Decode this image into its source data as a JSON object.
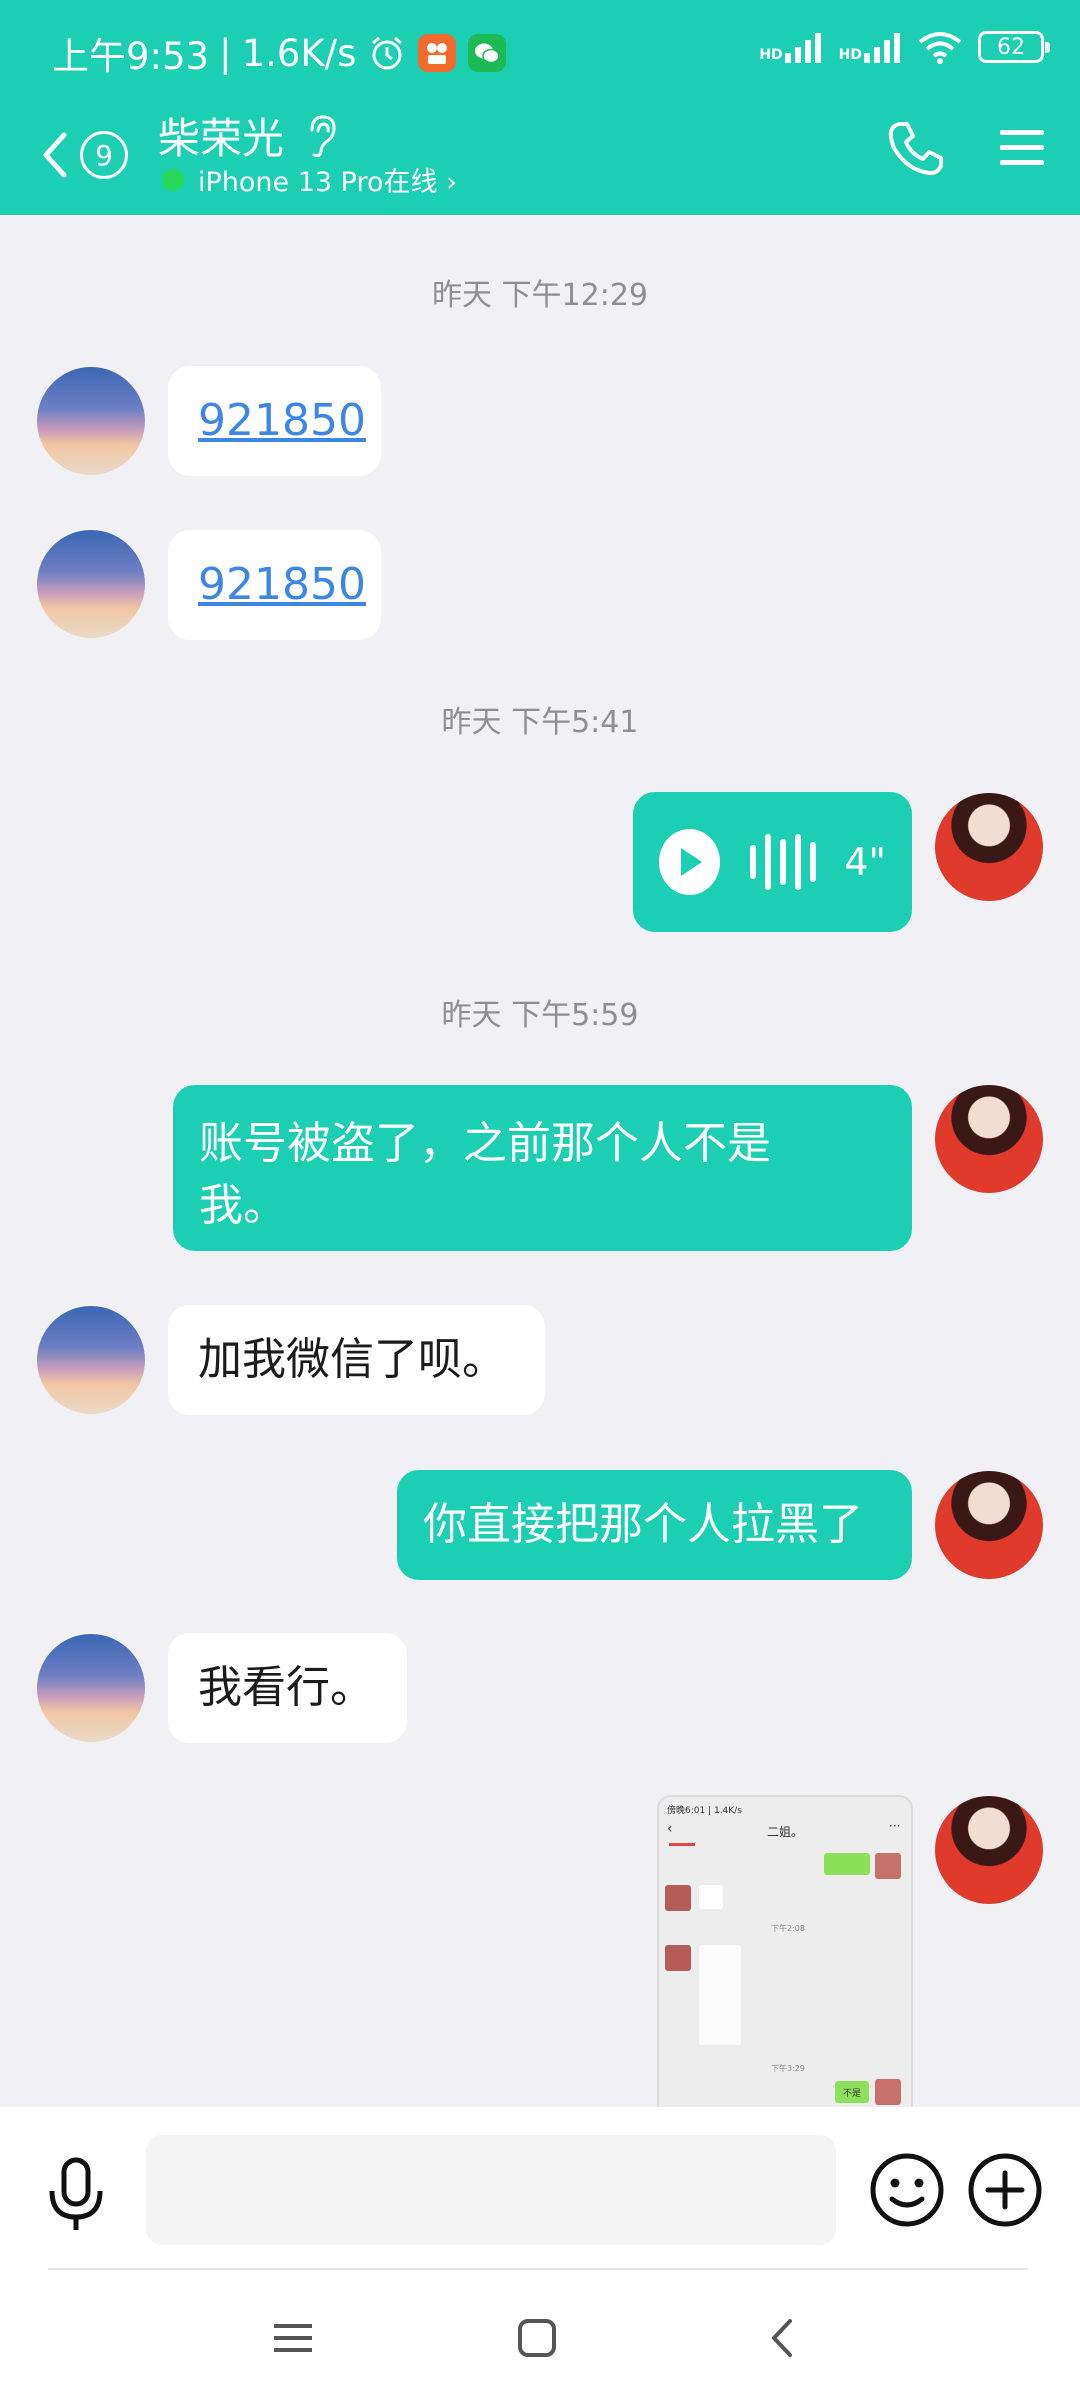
{
  "status_bar": {
    "time": "上午9:53",
    "speed": "1.6K/s",
    "battery": "62",
    "signal_label_1": "HD",
    "signal_label_2": "HD"
  },
  "header": {
    "unread_count": "9",
    "contact_name": "柴荣光",
    "online_status": "iPhone 13 Pro在线 ›",
    "accent_color": "#1ccfb2"
  },
  "messages": [
    {
      "type": "time",
      "text": "昨天 下午12:29"
    },
    {
      "type": "text",
      "from": "peer",
      "text": "921850",
      "is_link": true
    },
    {
      "type": "text",
      "from": "peer",
      "text": "921850",
      "is_link": true
    },
    {
      "type": "time",
      "text": "昨天 下午5:41"
    },
    {
      "type": "voice",
      "from": "self",
      "duration": "4\""
    },
    {
      "type": "time",
      "text": "昨天 下午5:59"
    },
    {
      "type": "text",
      "from": "self",
      "line1": "账号被盗了，之前那个人不是",
      "line2": "我。"
    },
    {
      "type": "text",
      "from": "peer",
      "text": "加我微信了呗。"
    },
    {
      "type": "text",
      "from": "self",
      "text": "你直接把那个人拉黑了"
    },
    {
      "type": "text",
      "from": "peer",
      "text": "我看行。"
    },
    {
      "type": "image",
      "from": "self"
    }
  ],
  "image_preview": {
    "status": "傍晚6:01 | 1.4K/s",
    "title": "二姐。",
    "time1": "下午2:08",
    "time2": "下午3:29",
    "bubble": "不是"
  },
  "input": {
    "placeholder": "",
    "value": ""
  },
  "icons": {
    "back": "chevron-left-icon",
    "ear": "ear-icon",
    "call": "phone-icon",
    "menu": "hamburger-menu-icon",
    "mic": "microphone-icon",
    "emoji": "smiley-icon",
    "plus": "plus-circle-icon",
    "nav_menu": "recent-apps-icon",
    "nav_home": "home-icon",
    "nav_back": "back-icon"
  }
}
